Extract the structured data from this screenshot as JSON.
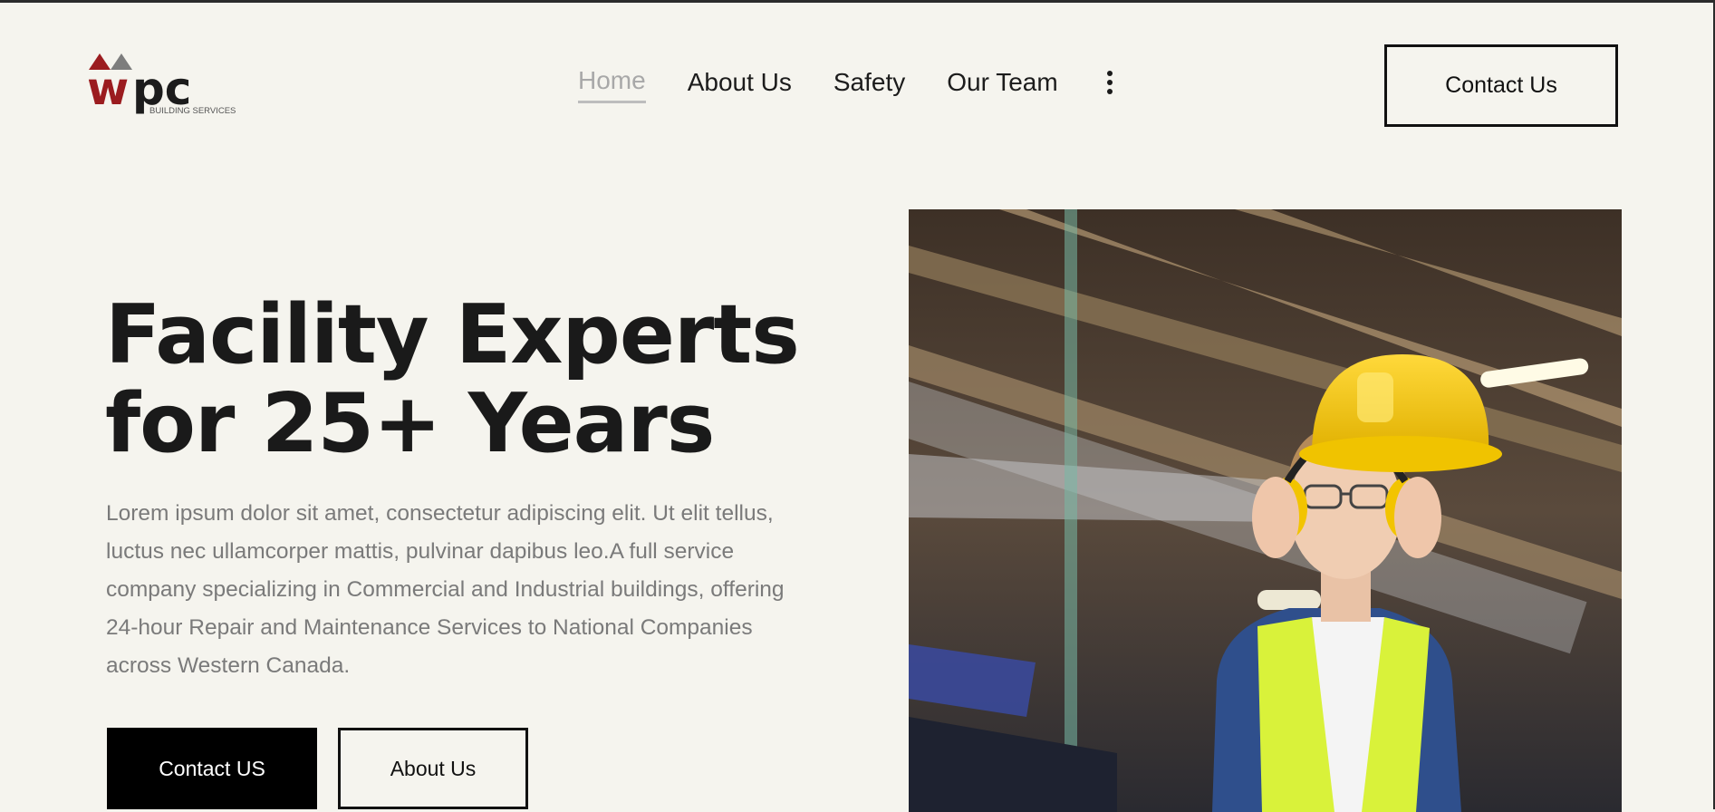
{
  "header": {
    "logo": {
      "mark": "wpc",
      "tagline": "BUILDING SERVICES"
    },
    "nav": {
      "items": [
        {
          "label": "Home",
          "active": true
        },
        {
          "label": "About Us"
        },
        {
          "label": "Safety"
        },
        {
          "label": "Our Team"
        }
      ],
      "more_icon": "kebab-vertical-icon"
    },
    "contact_button": "Contact Us"
  },
  "hero": {
    "headline_line1": "Facility Experts",
    "headline_line2": "for 25+ Years",
    "description": "Lorem ipsum dolor sit amet, consectetur adipiscing elit. Ut elit tellus, luctus nec ullamcorper mattis, pulvinar dapibus leo.A full service company specializing in Commercial and Industrial buildings, offering 24-hour Repair and Maintenance Services to National Companies across Western Canada.",
    "primary_button": "Contact US",
    "secondary_button": "About Us",
    "image_subject": "worker in yellow hard hat, safety glasses, ear protection and hi-vis vest in a warehouse"
  },
  "colors": {
    "background": "#f5f4ee",
    "text": "#1a1a1a",
    "muted_text": "#7a7a7a",
    "nav_active": "#a8a8a8",
    "logo_red": "#9b1c1f",
    "primary_button_bg": "#000000"
  }
}
